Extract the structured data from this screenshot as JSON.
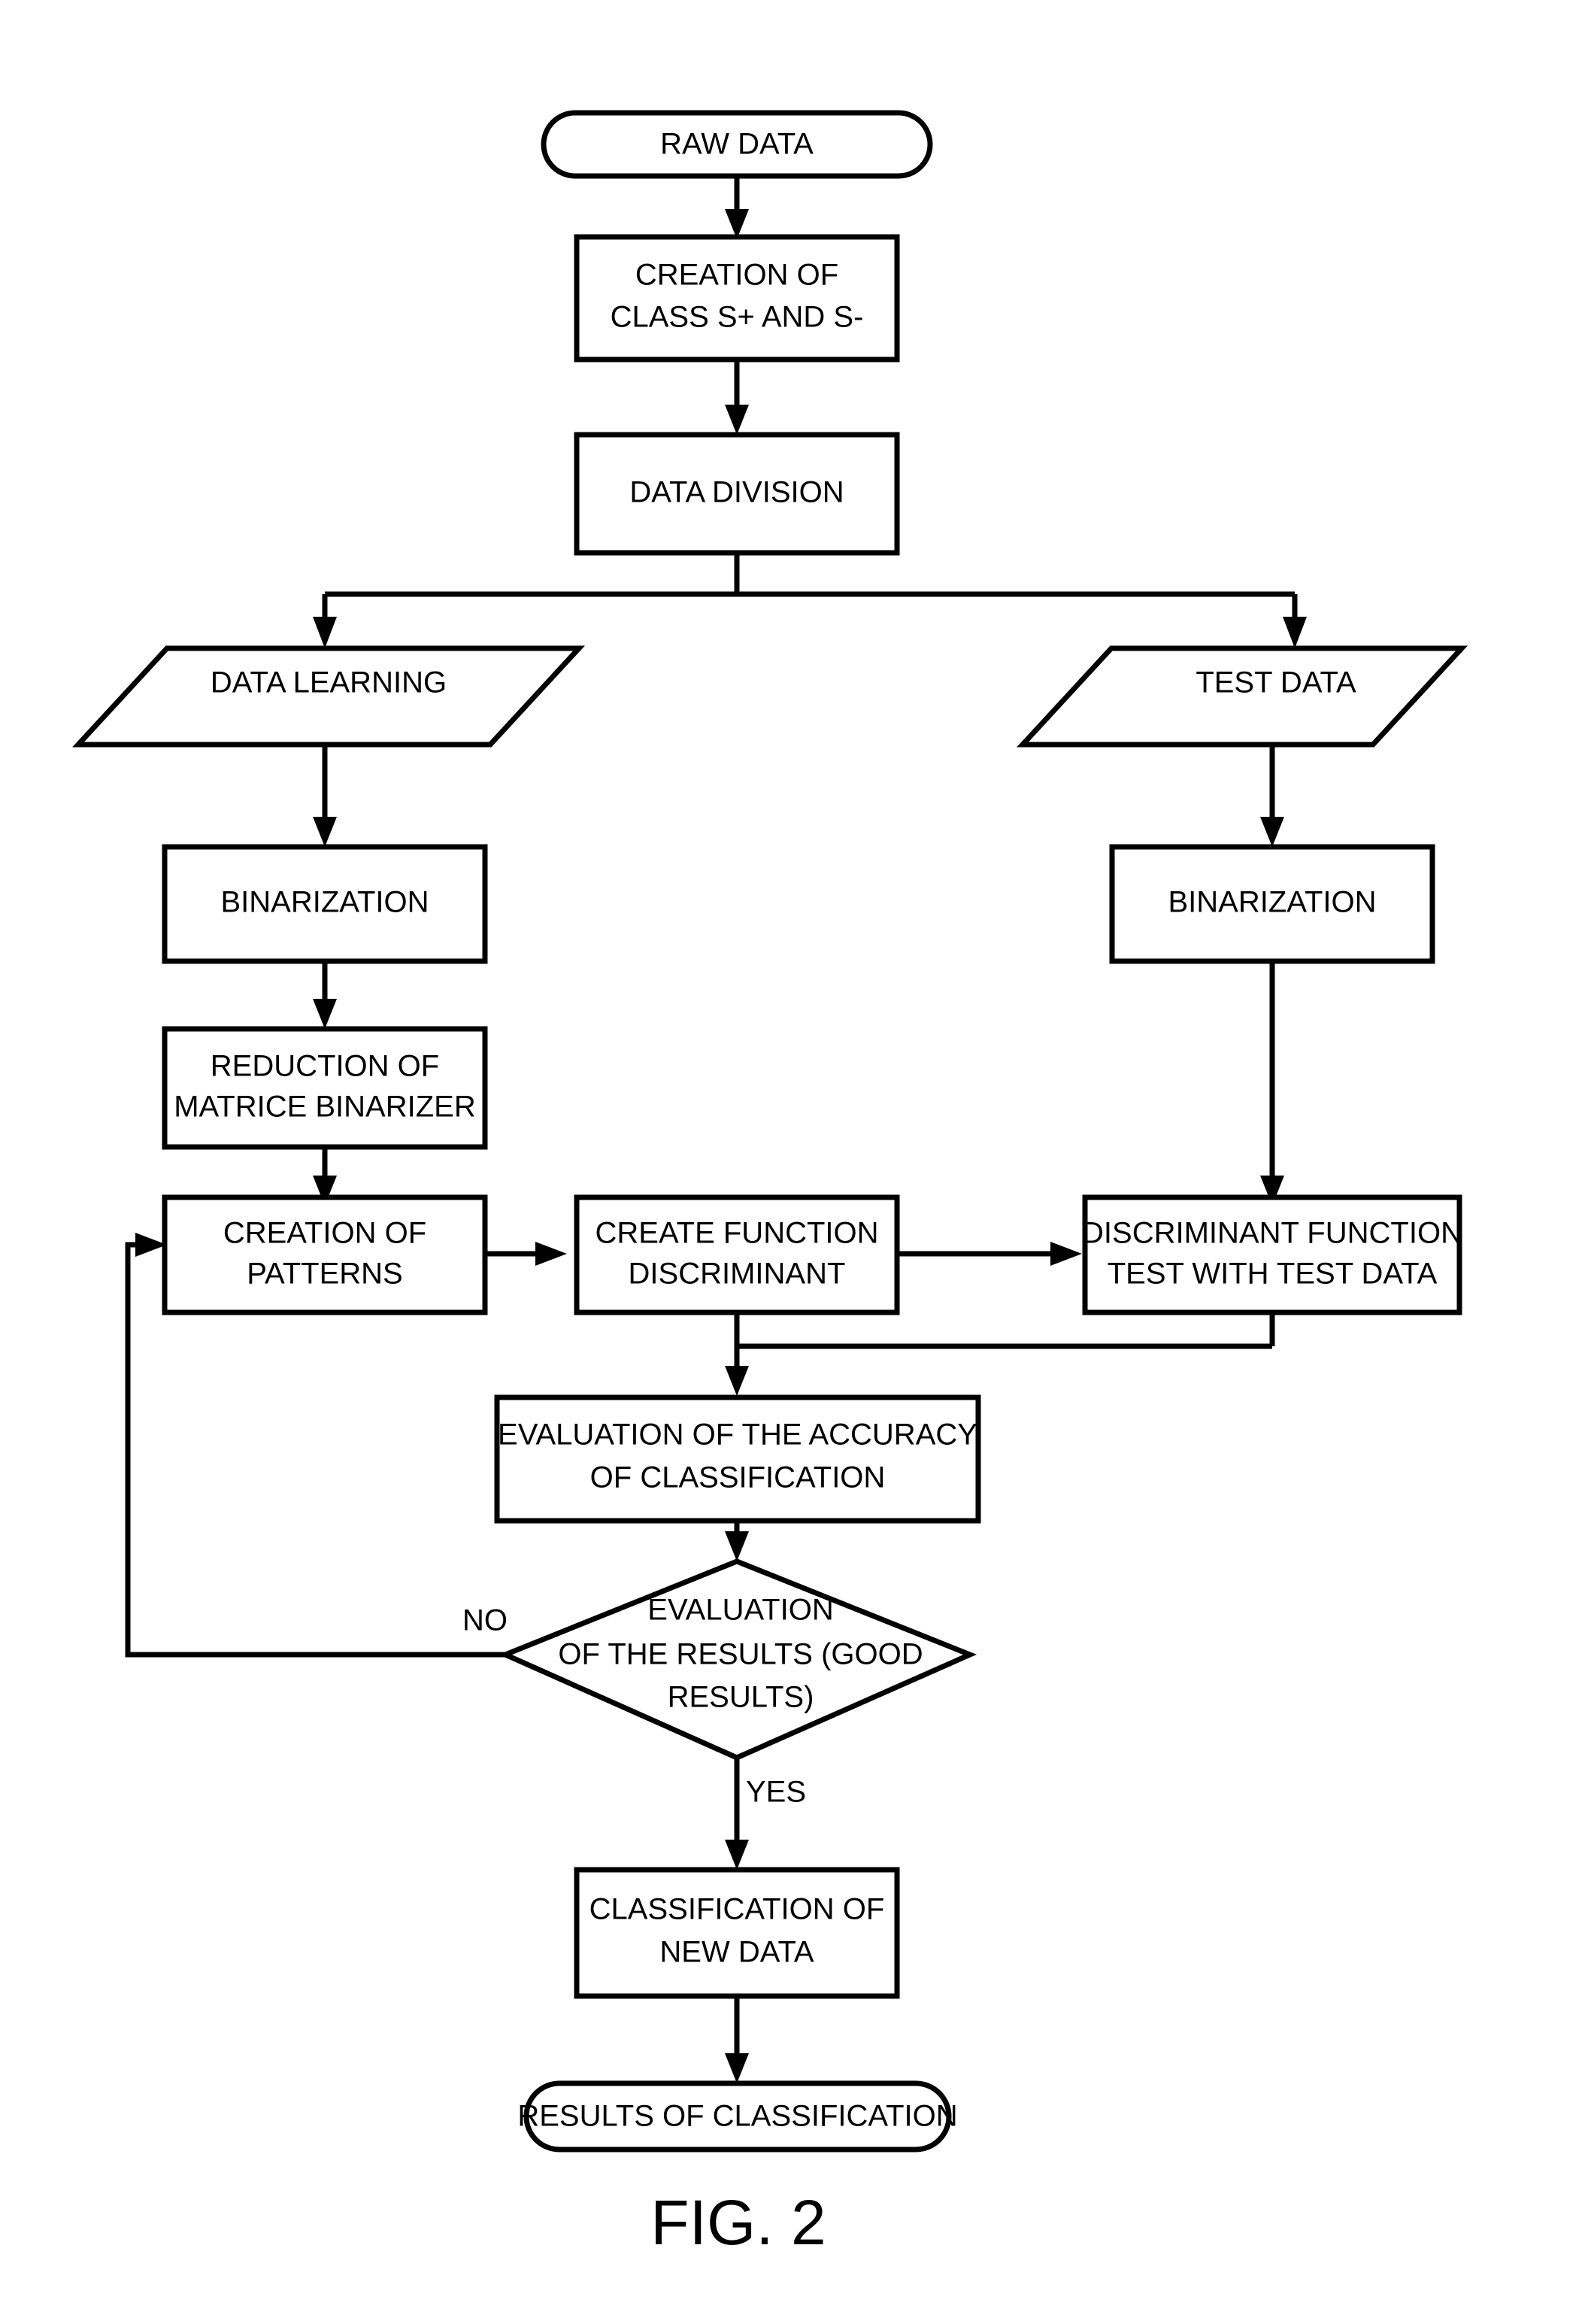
{
  "figure": {
    "caption": "FIG. 2",
    "background_color": "#ffffff",
    "line_color": "#000000"
  },
  "chart_data": {
    "type": "diagram",
    "subtype": "flowchart",
    "title": "FIG. 2",
    "nodes": [
      {
        "id": "raw_data",
        "shape": "terminator",
        "label": "RAW DATA"
      },
      {
        "id": "creation_class",
        "shape": "process",
        "label": "CREATION OF\nCLASS S+ AND S-"
      },
      {
        "id": "data_division",
        "shape": "process",
        "label": "DATA DIVISION"
      },
      {
        "id": "data_learning",
        "shape": "parallelogram",
        "label": "DATA LEARNING"
      },
      {
        "id": "test_data",
        "shape": "parallelogram",
        "label": "TEST DATA"
      },
      {
        "id": "binarization_l",
        "shape": "process",
        "label": "BINARIZATION"
      },
      {
        "id": "binarization_r",
        "shape": "process",
        "label": "BINARIZATION"
      },
      {
        "id": "reduction",
        "shape": "process",
        "label": "REDUCTION OF\nMATRICE BINARIZER"
      },
      {
        "id": "creation_pat",
        "shape": "process",
        "label": "CREATION OF\nPATTERNS"
      },
      {
        "id": "create_func",
        "shape": "process",
        "label": "CREATE FUNCTION\nDISCRIMINANT"
      },
      {
        "id": "disc_test",
        "shape": "process",
        "label": "DISCRIMINANT FUNCTION\nTEST WITH TEST DATA"
      },
      {
        "id": "evaluation_acc",
        "shape": "process",
        "label": "EVALUATION OF THE ACCURACY\nOF CLASSIFICATION"
      },
      {
        "id": "decision",
        "shape": "decision",
        "label": "EVALUATION\nOF THE RESULTS (GOOD\nRESULTS)"
      },
      {
        "id": "classify_new",
        "shape": "process",
        "label": "CLASSIFICATION OF\nNEW DATA"
      },
      {
        "id": "results",
        "shape": "terminator",
        "label": "RESULTS OF CLASSIFICATION"
      }
    ],
    "edges": [
      {
        "from": "raw_data",
        "to": "creation_class",
        "label": ""
      },
      {
        "from": "creation_class",
        "to": "data_division",
        "label": ""
      },
      {
        "from": "data_division",
        "to": "data_learning",
        "label": ""
      },
      {
        "from": "data_division",
        "to": "test_data",
        "label": ""
      },
      {
        "from": "data_learning",
        "to": "binarization_l",
        "label": ""
      },
      {
        "from": "test_data",
        "to": "binarization_r",
        "label": ""
      },
      {
        "from": "binarization_l",
        "to": "reduction",
        "label": ""
      },
      {
        "from": "reduction",
        "to": "creation_pat",
        "label": ""
      },
      {
        "from": "creation_pat",
        "to": "create_func",
        "label": ""
      },
      {
        "from": "create_func",
        "to": "disc_test",
        "label": ""
      },
      {
        "from": "binarization_r",
        "to": "disc_test",
        "label": ""
      },
      {
        "from": "create_func",
        "to": "evaluation_acc",
        "label": ""
      },
      {
        "from": "disc_test",
        "to": "evaluation_acc",
        "label": ""
      },
      {
        "from": "evaluation_acc",
        "to": "decision",
        "label": ""
      },
      {
        "from": "decision",
        "to": "creation_pat",
        "label": "NO"
      },
      {
        "from": "decision",
        "to": "classify_new",
        "label": "YES"
      },
      {
        "from": "classify_new",
        "to": "results",
        "label": ""
      }
    ]
  },
  "nodes": {
    "raw_data": {
      "line1": "RAW DATA"
    },
    "creation_class": {
      "line1": "CREATION OF",
      "line2": "CLASS S+ AND S-"
    },
    "data_division": {
      "line1": "DATA DIVISION"
    },
    "data_learning": {
      "line1": "DATA LEARNING"
    },
    "test_data": {
      "line1": "TEST DATA"
    },
    "binarization_l": {
      "line1": "BINARIZATION"
    },
    "binarization_r": {
      "line1": "BINARIZATION"
    },
    "reduction": {
      "line1": "REDUCTION OF",
      "line2": "MATRICE BINARIZER"
    },
    "creation_pat": {
      "line1": "CREATION OF",
      "line2": "PATTERNS"
    },
    "create_func": {
      "line1": "CREATE FUNCTION",
      "line2": "DISCRIMINANT"
    },
    "disc_test": {
      "line1": "DISCRIMINANT FUNCTION",
      "line2": "TEST WITH TEST DATA"
    },
    "evaluation_acc": {
      "line1": "EVALUATION OF THE ACCURACY",
      "line2": "OF CLASSIFICATION"
    },
    "decision": {
      "line1": "EVALUATION",
      "line2": "OF THE RESULTS (GOOD",
      "line3": "RESULTS)"
    },
    "classify_new": {
      "line1": "CLASSIFICATION OF",
      "line2": "NEW DATA"
    },
    "results": {
      "line1": "RESULTS OF CLASSIFICATION"
    }
  },
  "branch_labels": {
    "no": "NO",
    "yes": "YES"
  }
}
